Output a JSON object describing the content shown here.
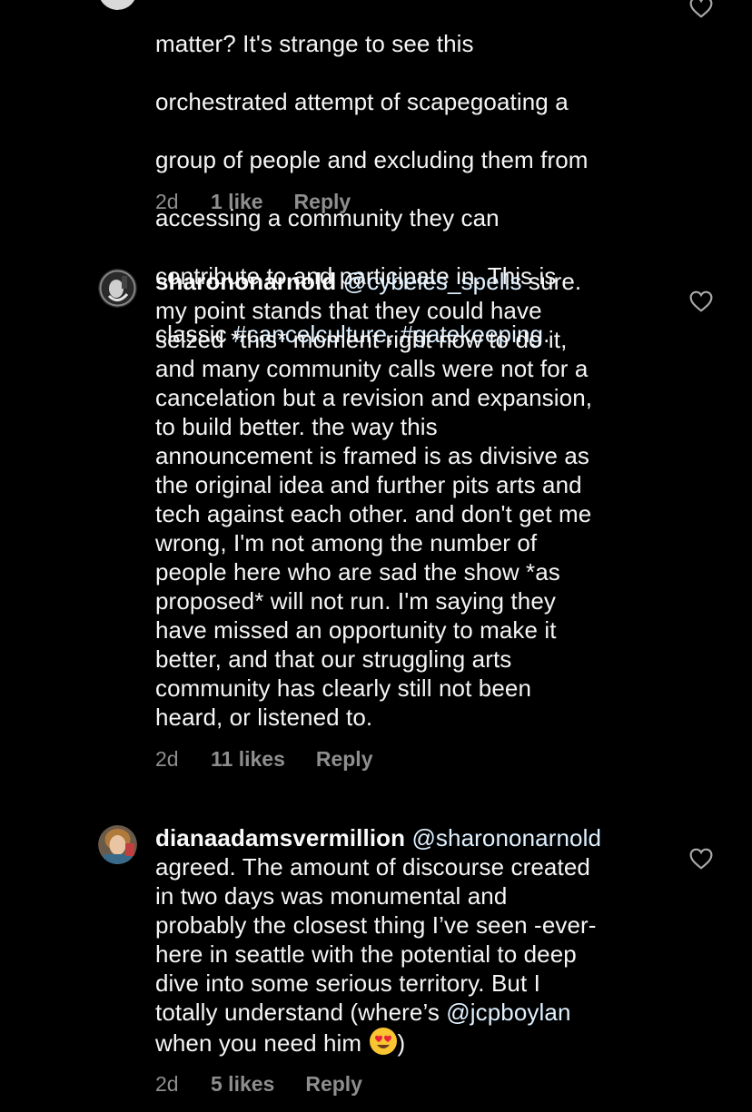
{
  "comments": [
    {
      "username": "",
      "mention": "",
      "lines": [
        "matter? It's strange to see this",
        "orchestrated attempt of scapegoating a",
        "group of people and excluding them from",
        "accessing a community they can",
        "contribute to and participate in. This is"
      ],
      "last_line_prefix": "classic ",
      "hashtag_1": "#cancelculture",
      "separator": ", ",
      "hashtag_2": "#gatekeeping",
      "last_line_suffix": ".",
      "time": "2d",
      "likes": "1 like",
      "reply": "Reply",
      "avatar_icon": "avatar-partial-icon",
      "heart_icon": "heart-outline-icon"
    },
    {
      "username": "sharononarnold",
      "mention": "@cybeles_spells",
      "text": " sure.\nmy point stands that they could have\nseized *this* moment right now to do it,\nand many community calls were not for a\ncancelation but a revision and expansion,\nto build better. the way this\nannouncement is framed is as divisive as\nthe original idea and further pits arts and\ntech against each other. and don't get me\nwrong, I'm not among the number of\npeople here who are sad the show *as\nproposed* will not run. I'm saying they\nhave missed an opportunity to make it\nbetter, and that our struggling arts\ncommunity has clearly still not been\nheard, or listened to.",
      "time": "2d",
      "likes": "11 likes",
      "reply": "Reply",
      "avatar_icon": "avatar-sharononarnold-icon",
      "heart_icon": "heart-outline-icon"
    },
    {
      "username": "dianaadamsvermillion",
      "mention": "@sharononarnold",
      "text_a": "\nagreed. The amount of discourse created\nin two days was monumental and\nprobably the closest thing I’ve seen -ever-\nhere in seattle with the potential to deep\ndive into some serious territory. But I\ntotally understand (where’s ",
      "mention_2": "@jcpboylan",
      "text_b": "\nwhen you need him ",
      "emoji": "heart-eyes-emoji-icon",
      "text_c": ")",
      "time": "2d",
      "likes": "5 likes",
      "reply": "Reply",
      "avatar_icon": "avatar-dianaadamsvermillion-icon",
      "heart_icon": "heart-outline-icon"
    }
  ],
  "colors": {
    "background": "#000000",
    "text": "#f5f5f5",
    "meta": "#8e8e8e",
    "mention": "#e0f1ff"
  }
}
